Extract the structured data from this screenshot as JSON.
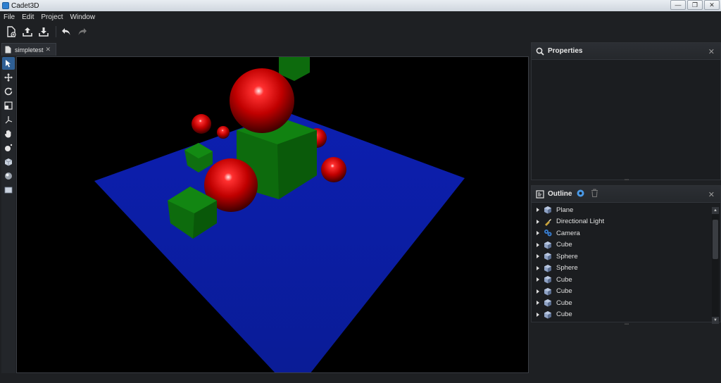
{
  "window": {
    "title": "Cadet3D",
    "buttons": [
      "—",
      "❐",
      "✕"
    ]
  },
  "menu": [
    "File",
    "Edit",
    "Project",
    "Window"
  ],
  "toolbar": {
    "icons": [
      "new-file-icon",
      "upload-icon",
      "download-icon",
      "undo-icon",
      "redo-icon"
    ]
  },
  "document_tab": {
    "label": "simpletest",
    "close": "✕"
  },
  "tools": [
    "select-tool-icon",
    "move-tool-icon",
    "rotate-tool-icon",
    "scale-tool-icon",
    "axis-tool-icon",
    "hand-tool-icon",
    "light-tool-icon",
    "cube-tool-icon",
    "sphere-tool-icon",
    "plane-tool-icon"
  ],
  "properties": {
    "title": "Properties",
    "close": "✕"
  },
  "outline": {
    "title": "Outline",
    "close": "✕",
    "items": [
      {
        "label": "Plane",
        "icon": "cube-icon"
      },
      {
        "label": "Directional Light",
        "icon": "light-icon"
      },
      {
        "label": "Camera",
        "icon": "camera-icon"
      },
      {
        "label": "Cube",
        "icon": "cube-icon"
      },
      {
        "label": "Sphere",
        "icon": "cube-icon"
      },
      {
        "label": "Sphere",
        "icon": "cube-icon"
      },
      {
        "label": "Cube",
        "icon": "cube-icon"
      },
      {
        "label": "Cube",
        "icon": "cube-icon"
      },
      {
        "label": "Cube",
        "icon": "cube-icon"
      },
      {
        "label": "Cube",
        "icon": "cube-icon"
      }
    ]
  },
  "colors": {
    "plane": "#0a1fa8",
    "sphere": "#c00000",
    "cube": "#0d6b0d",
    "accent": "#2f5f94"
  }
}
